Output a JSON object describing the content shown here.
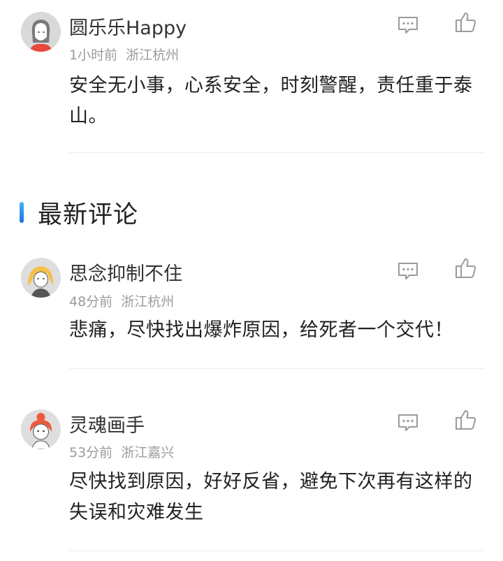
{
  "comments_top": [
    {
      "user": "圆乐乐Happy",
      "time": "1小时前",
      "location": "浙江杭州",
      "text": "安全无小事，心系安全，时刻警醒，责任重于泰山。"
    }
  ],
  "section": {
    "title": "最新评论",
    "accent_color": "#1f6fe0"
  },
  "comments_latest": [
    {
      "user": "思念抑制不住",
      "time": "48分前",
      "location": "浙江杭州",
      "text": "悲痛，尽快找出爆炸原因，给死者一个交代！"
    },
    {
      "user": "灵魂画手",
      "time": "53分前",
      "location": "浙江嘉兴",
      "text": "尽快找到原因，好好反省，避免下次再有这样的失误和灾难发生"
    }
  ],
  "icons": {
    "reply": "comment-bubble-icon",
    "like": "thumbs-up-icon"
  },
  "colors": {
    "meta_text": "#9b9b9b",
    "icon": "#9a9a9a",
    "divider": "#ececec"
  }
}
